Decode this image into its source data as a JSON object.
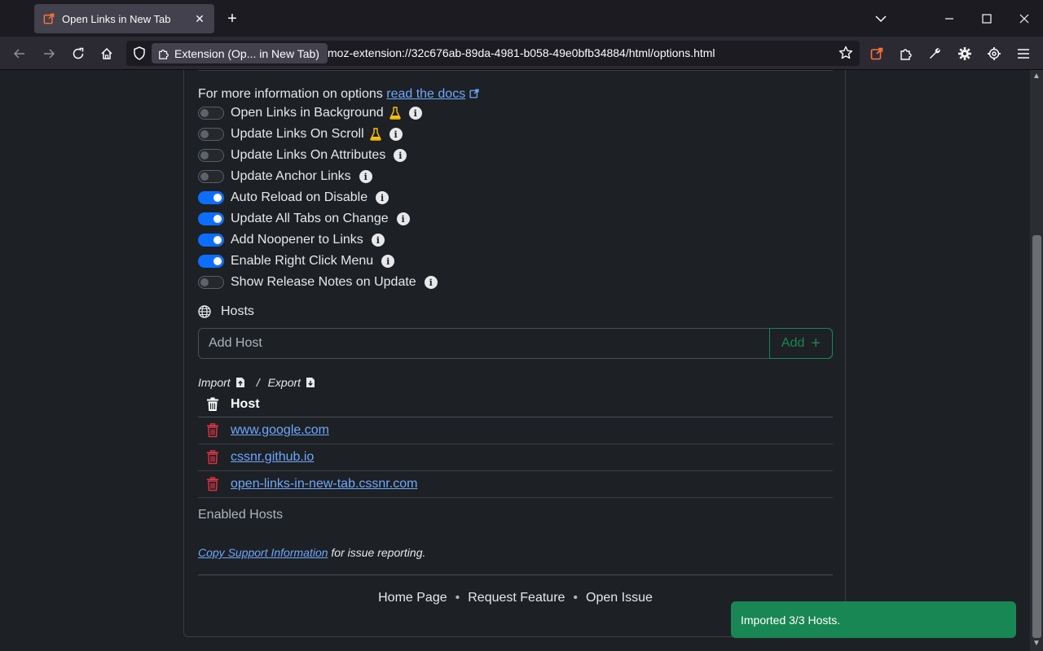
{
  "browser": {
    "tab": {
      "title": "Open Links in New Tab"
    },
    "urlbar": {
      "identity_label": "Extension (Op... in New Tab)",
      "url": "moz-extension://32c676ab-89da-4981-b058-49e0bfb34884/html/options.html"
    }
  },
  "page": {
    "info_text": "For more information on options",
    "docs_link": "read the docs",
    "options": [
      {
        "label": "Open Links in Background",
        "enabled": false,
        "experimental": true
      },
      {
        "label": "Update Links On Scroll",
        "enabled": false,
        "experimental": true
      },
      {
        "label": "Update Links On Attributes",
        "enabled": false,
        "experimental": false
      },
      {
        "label": "Update Anchor Links",
        "enabled": false,
        "experimental": false
      },
      {
        "label": "Auto Reload on Disable",
        "enabled": true,
        "experimental": false
      },
      {
        "label": "Update All Tabs on Change",
        "enabled": true,
        "experimental": false
      },
      {
        "label": "Add Noopener to Links",
        "enabled": true,
        "experimental": false
      },
      {
        "label": "Enable Right Click Menu",
        "enabled": true,
        "experimental": false
      },
      {
        "label": "Show Release Notes on Update",
        "enabled": false,
        "experimental": false
      }
    ],
    "hosts": {
      "heading": "Hosts",
      "input_placeholder": "Add Host",
      "add_label": "Add",
      "import_label": "Import",
      "separator": "/",
      "export_label": "Export",
      "column_header": "Host",
      "rows": [
        "www.google.com",
        "cssnr.github.io",
        "open-links-in-new-tab.cssnr.com"
      ],
      "enabled_label": "Enabled Hosts"
    },
    "support": {
      "link": "Copy Support Information",
      "suffix": "for issue reporting."
    },
    "footer": {
      "links": [
        "Home Page",
        "Request Feature",
        "Open Issue"
      ],
      "separator": "•"
    }
  },
  "toast": {
    "message": "Imported 3/3 Hosts."
  },
  "colors": {
    "accent": "#0d6efd",
    "success": "#198754",
    "danger": "#dc3545",
    "link": "#6ea8fe",
    "warning": "#ffc107",
    "ext_orange": "#ff7139"
  }
}
